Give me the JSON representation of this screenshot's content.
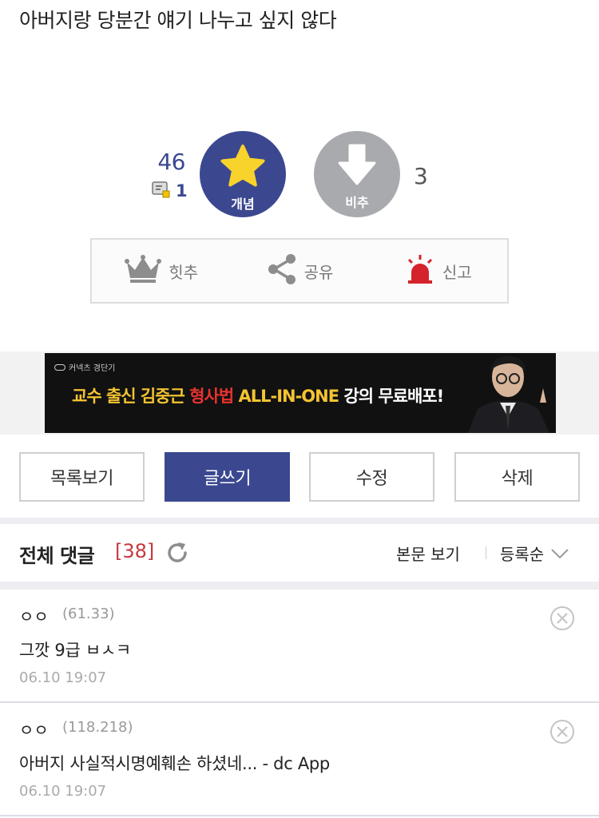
{
  "post": {
    "body_text": "아버지랑 당분간 얘기 나누고 싶지 않다"
  },
  "vote": {
    "recommend_count": "46",
    "fixed_recommend_count": "1",
    "recommend_label": "개념",
    "downvote_label": "비추",
    "downvote_count": "3"
  },
  "actions": {
    "hit_label": "힛추",
    "share_label": "공유",
    "report_label": "신고"
  },
  "ad": {
    "brand": "커넥츠 경단기",
    "headline_1": "교수 출신 김중근",
    "headline_2": "형사법",
    "headline_3": "ALL-IN-ONE",
    "headline_4": "강의",
    "headline_5": "무료배포!"
  },
  "buttons": {
    "list": "목록보기",
    "write": "글쓰기",
    "edit": "수정",
    "delete": "삭제"
  },
  "comments_header": {
    "title": "전체 댓글",
    "count": "[38]",
    "view_body": "본문 보기",
    "sort": "등록순"
  },
  "comments": [
    {
      "nick": "ㅇㅇ",
      "ip": "(61.33)",
      "text": "그깟 9급 ㅂㅅㅋ",
      "date": "06.10 19:07"
    },
    {
      "nick": "ㅇㅇ",
      "ip": "(118.218)",
      "text": "아버지 사실적시명예훼손 하셨네... - dc App",
      "date": "06.10 19:07"
    }
  ],
  "colors": {
    "accent": "#3b4890",
    "downvote": "#a9aaae",
    "comment_count": "#c6383f",
    "ad_yellow": "#f4c431",
    "ad_red": "#e8332e"
  }
}
